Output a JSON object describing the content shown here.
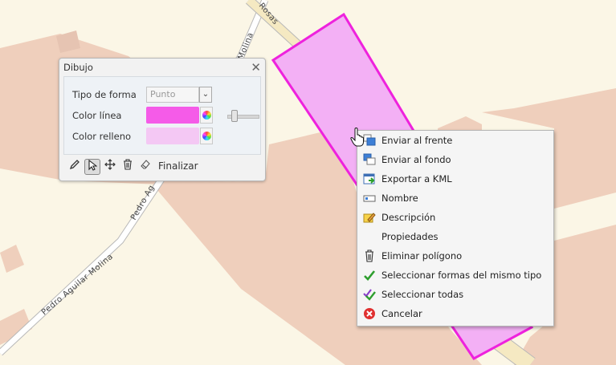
{
  "map": {
    "streets": [
      "Pedro Aguilar Molina",
      "Molina",
      "Pedro Ag",
      "Rosas"
    ],
    "colors": {
      "background": "#fbf6e6",
      "building": "#efcfbc",
      "street": "#ffffff",
      "polygon_fill": "#f3b0f5",
      "polygon_stroke": "#ee22dd"
    }
  },
  "draw_panel": {
    "title": "Dibujo",
    "shape_type_label": "Tipo de forma",
    "shape_type_value": "Punto",
    "line_color_label": "Color línea",
    "line_color": "#f55be8",
    "fill_color_label": "Color relleno",
    "fill_color": "#f4c8f4",
    "toolbar": {
      "tools": [
        "pencil-icon",
        "select-arrow-icon",
        "move-icon",
        "trash-icon",
        "eraser-icon"
      ],
      "finish_label": "Finalizar"
    }
  },
  "context_menu": {
    "items": [
      {
        "label": "Enviar al frente",
        "icon": "bring-to-front-icon"
      },
      {
        "label": "Enviar al fondo",
        "icon": "send-to-back-icon"
      },
      {
        "label": "Exportar a KML",
        "icon": "export-kml-icon"
      },
      {
        "label": "Nombre",
        "icon": "name-tag-icon"
      },
      {
        "label": "Descripción",
        "icon": "description-icon"
      },
      {
        "label": "Propiedades",
        "icon": ""
      },
      {
        "label": "Eliminar polígono",
        "icon": "trash-icon"
      },
      {
        "label": "Seleccionar formas del mismo tipo",
        "icon": "check-icon"
      },
      {
        "label": "Seleccionar todas",
        "icon": "check-all-icon"
      },
      {
        "label": "Cancelar",
        "icon": "cancel-icon"
      }
    ]
  }
}
